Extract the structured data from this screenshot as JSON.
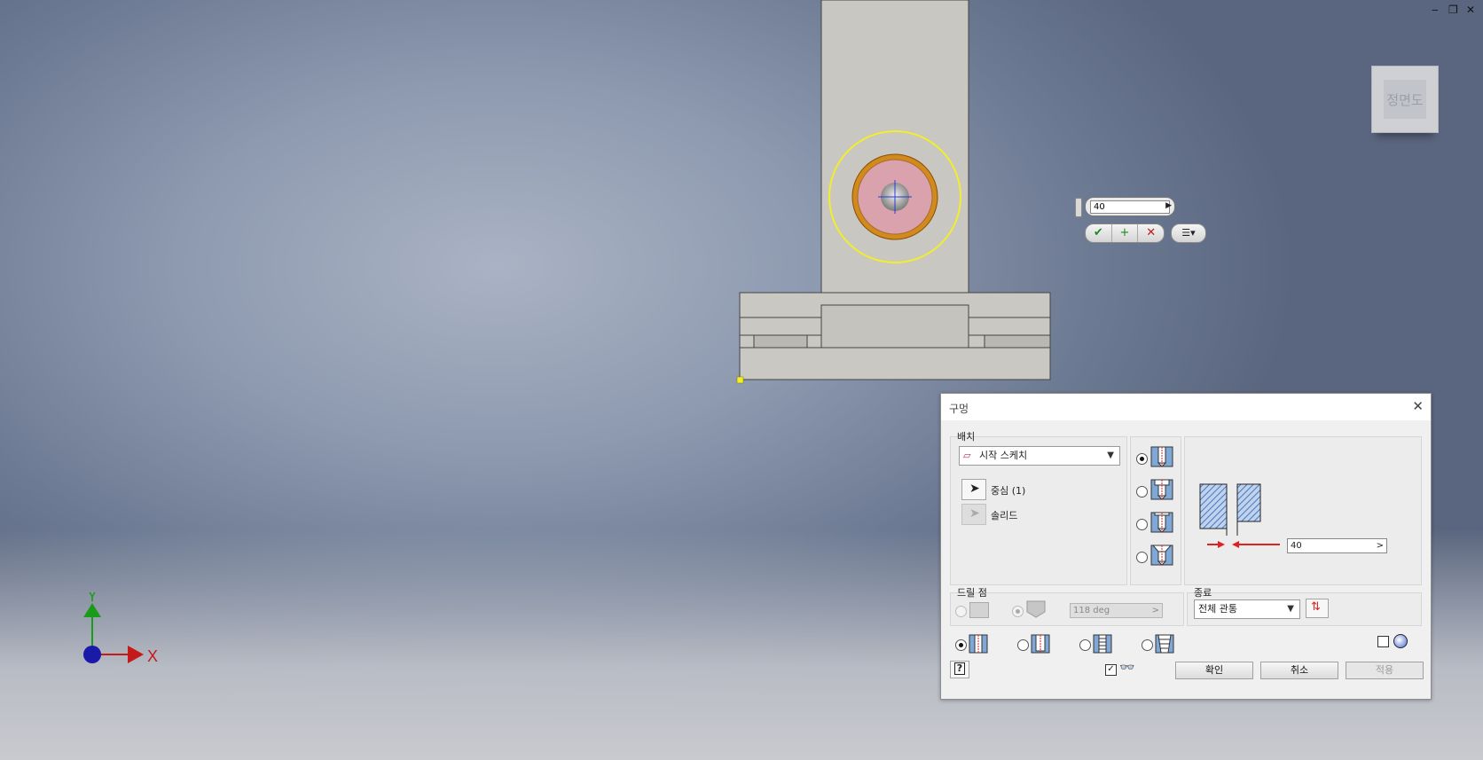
{
  "window_controls": {
    "minimize": "‒",
    "restore": "❐",
    "close": "✕"
  },
  "viewcube": {
    "label": "정면도"
  },
  "input_bubble": {
    "value": "40",
    "ok": "✔",
    "add": "+",
    "cancel": "✕"
  },
  "triad": {
    "y_label": "Y",
    "x_label": "X",
    "y_color": "#1a9c1a",
    "x_color": "#c41a1a",
    "origin_color": "#1a1aa8"
  },
  "colors": {
    "highlight_ring": "#f2ee2a",
    "hole_fill": "#d9a2ad",
    "hole_rim": "#c87a10",
    "part_gray": "#c8c7c2"
  },
  "dialog": {
    "title": "구멍",
    "close": "✕",
    "placement": {
      "label": "배치",
      "type_value": "시작 스케치",
      "center_label": "중심 (1)",
      "solid_label": "솔리드"
    },
    "dimension_value": "40",
    "drill_point": {
      "label": "드릴 점",
      "angle": "118 deg"
    },
    "termination": {
      "label": "종료",
      "value": "전체 관통"
    },
    "buttons": {
      "ok": "확인",
      "cancel": "취소",
      "apply": "적용"
    },
    "help": "?"
  }
}
